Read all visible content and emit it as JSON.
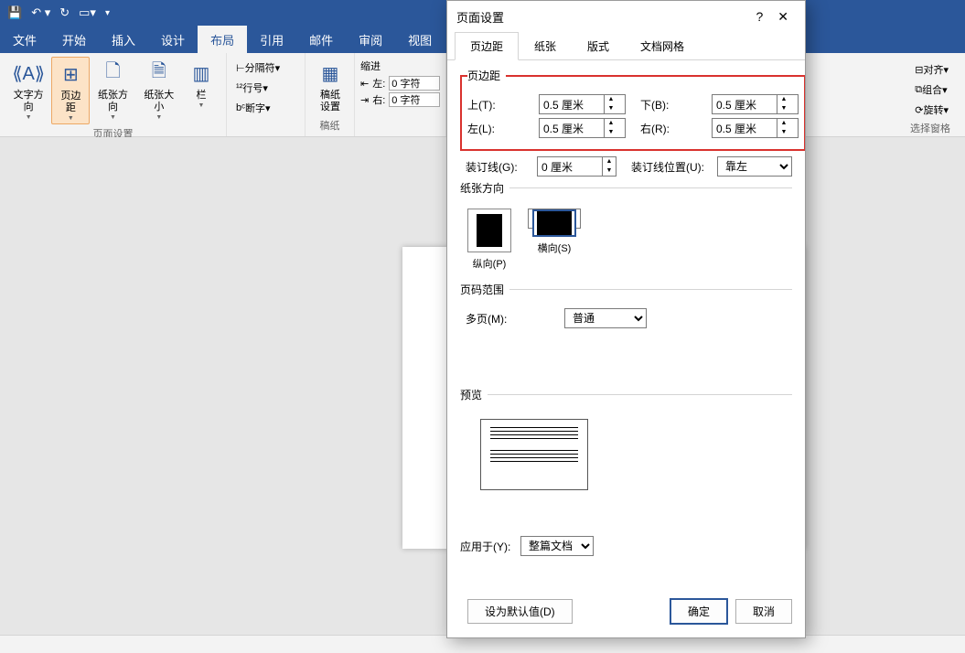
{
  "menubar": [
    "文件",
    "开始",
    "插入",
    "设计",
    "布局",
    "引用",
    "邮件",
    "审阅",
    "视图"
  ],
  "menubar_active": 4,
  "ribbon": {
    "group1_label": "页面设置",
    "btn_text_dir": "文字方向",
    "btn_margins": "页边距",
    "btn_orient": "纸张方向",
    "btn_size": "纸张大小",
    "btn_columns": "栏",
    "breaks": "分隔符",
    "line_numbers": "行号",
    "hyphenation": "断字",
    "group2_label": "稿纸",
    "btn_grid": "稿纸\n设置",
    "indent_label": "缩进",
    "indent_left_label": "左:",
    "indent_left_value": "0 字符",
    "indent_right_label": "右:",
    "indent_right_value": "0 字符",
    "align": "对齐",
    "group_obj": "组合",
    "pane": "选择窗格",
    "rotate": "旋转"
  },
  "dialog": {
    "title": "页面设置",
    "tabs": [
      "页边距",
      "纸张",
      "版式",
      "文档网格"
    ],
    "tabs_active": 0,
    "fs_margins": "页边距",
    "top_label": "上(T):",
    "top_value": "0.5 厘米",
    "bottom_label": "下(B):",
    "bottom_value": "0.5 厘米",
    "left_label": "左(L):",
    "left_value": "0.5 厘米",
    "right_label": "右(R):",
    "right_value": "0.5 厘米",
    "gutter_label": "装订线(G):",
    "gutter_value": "0 厘米",
    "gutter_pos_label": "装订线位置(U):",
    "gutter_pos_value": "靠左",
    "fs_orient": "纸张方向",
    "portrait": "纵向(P)",
    "landscape": "横向(S)",
    "fs_pages": "页码范围",
    "multipage_label": "多页(M):",
    "multipage_value": "普通",
    "fs_preview": "预览",
    "apply_to_label": "应用于(Y):",
    "apply_to_value": "整篇文档",
    "set_default": "设为默认值(D)",
    "ok": "确定",
    "cancel": "取消"
  },
  "statusbar": ""
}
